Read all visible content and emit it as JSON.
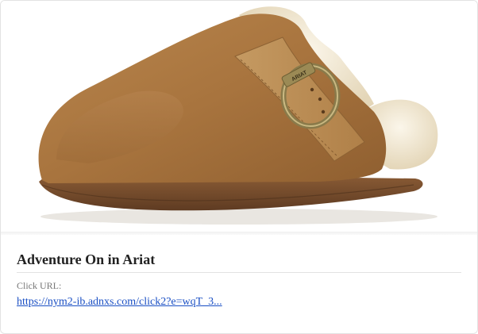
{
  "ad": {
    "image_alt": "Ariat suede clog with shearling lining and buckle strap",
    "buckle_brand_mark": "ARIAT",
    "title": "Adventure On in Ariat",
    "click_url_label": "Click URL:",
    "click_url": "https://nym2-ib.adnxs.com/click2?e=wqT_3..."
  },
  "colors": {
    "suede": "#a8743e",
    "shearling": "#f1e9d6",
    "sole": "#7a4f2e",
    "buckle": "#8a7a4a",
    "link": "#1a4fc4"
  }
}
